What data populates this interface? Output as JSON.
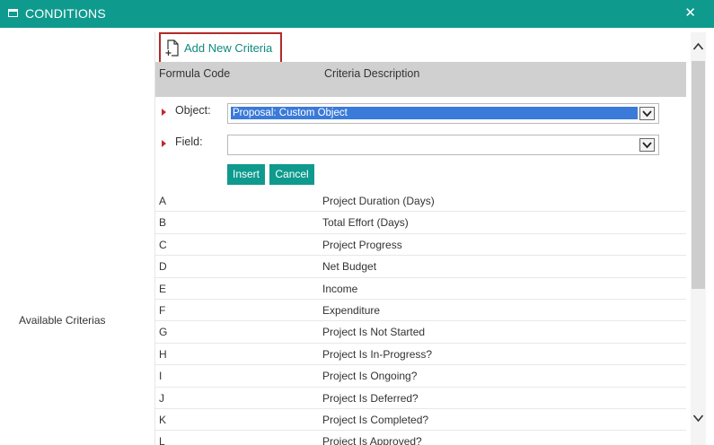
{
  "window": {
    "title": "CONDITIONS",
    "close_icon": "close-icon"
  },
  "left_panel": {
    "label": "Available Criterias"
  },
  "toolbar": {
    "add_new_criteria_label": "Add New Criteria",
    "add_icon": "new-document-icon"
  },
  "table_header": {
    "formula_code": "Formula Code",
    "criteria_description": "Criteria Description"
  },
  "form": {
    "object_label": "Object:",
    "object_value": "Proposal: Custom Object",
    "field_label": "Field:",
    "field_value": "",
    "insert_label": "Insert",
    "cancel_label": "Cancel"
  },
  "criteria": [
    {
      "code": "A",
      "description": "Project Duration (Days)"
    },
    {
      "code": "B",
      "description": "Total Effort (Days)"
    },
    {
      "code": "C",
      "description": "Project Progress"
    },
    {
      "code": "D",
      "description": "Net Budget"
    },
    {
      "code": "E",
      "description": "Income"
    },
    {
      "code": "F",
      "description": "Expenditure"
    },
    {
      "code": "G",
      "description": "Project Is Not Started"
    },
    {
      "code": "H",
      "description": "Project Is In-Progress?"
    },
    {
      "code": "I",
      "description": "Project Is Ongoing?"
    },
    {
      "code": "J",
      "description": "Project Is Deferred?"
    },
    {
      "code": "K",
      "description": "Project Is Completed?"
    },
    {
      "code": "L",
      "description": "Project Is Approved?"
    }
  ],
  "colors": {
    "accent": "#0f9a8e",
    "header_bg": "#d0d0d0",
    "required_marker": "#c0282f",
    "selection": "#3a7ad9"
  }
}
